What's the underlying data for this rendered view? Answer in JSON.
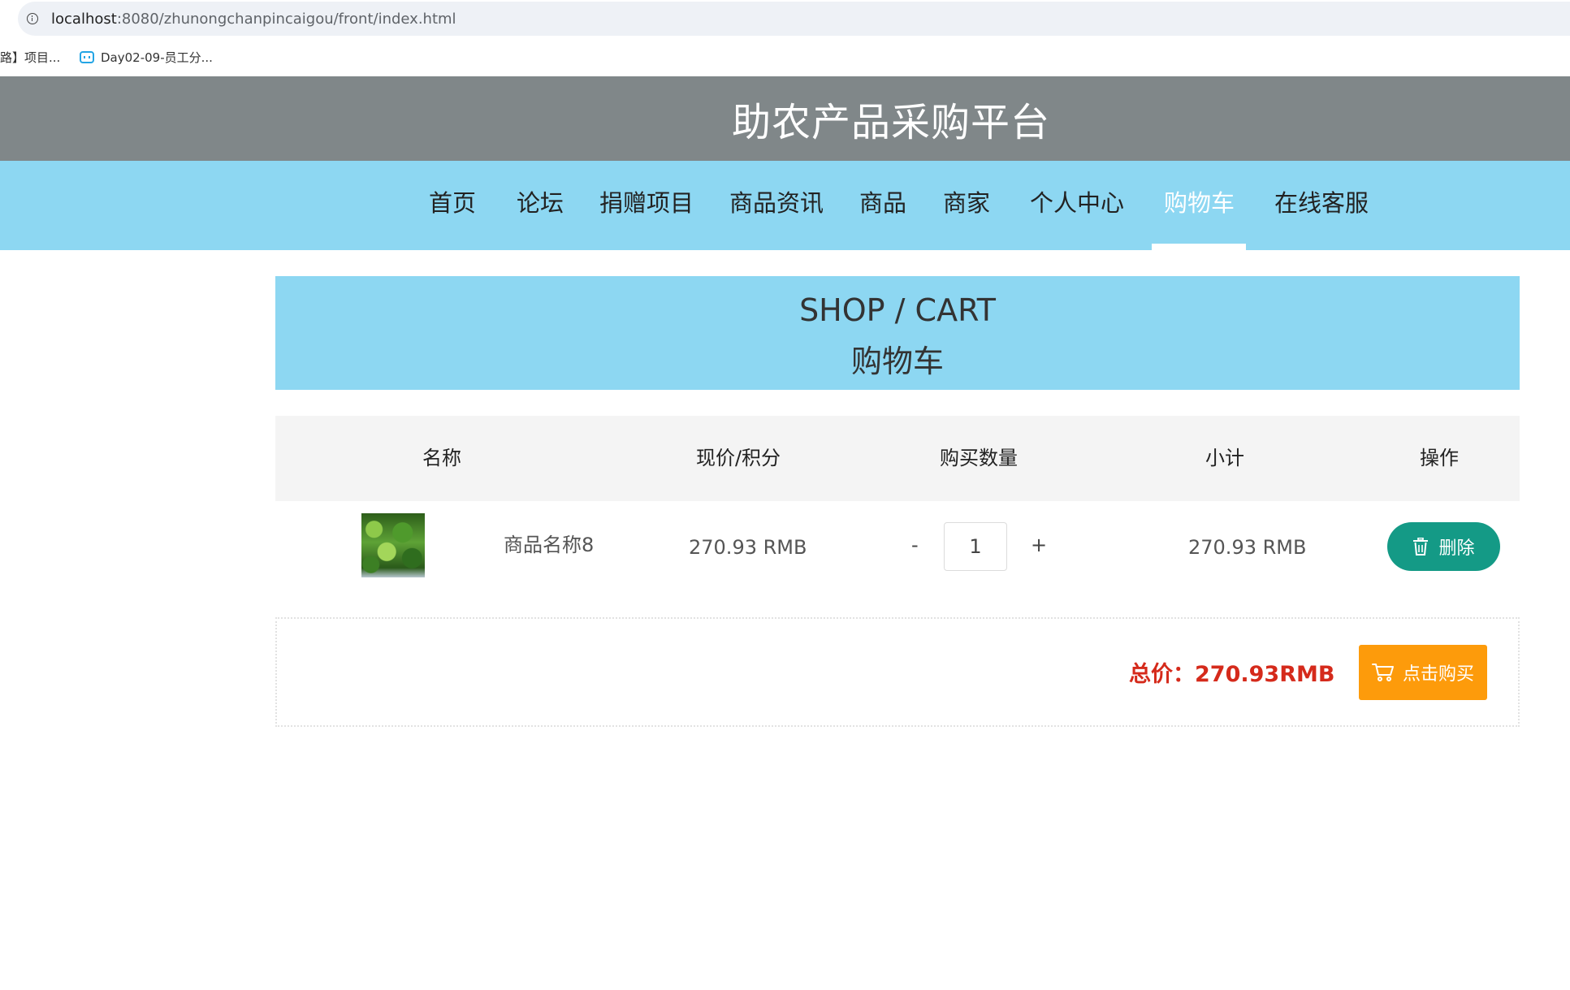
{
  "browser": {
    "url_host": "localhost",
    "url_rest": ":8080/zhunongchanpincaigou/front/index.html",
    "bookmarks": [
      "路】项目...",
      "Day02-09-员工分..."
    ]
  },
  "site": {
    "title": "助农产品采购平台"
  },
  "nav": {
    "items": [
      {
        "label": "首页"
      },
      {
        "label": "论坛"
      },
      {
        "label": "捐赠项目"
      },
      {
        "label": "商品资讯"
      },
      {
        "label": "商品"
      },
      {
        "label": "商家"
      },
      {
        "label": "个人中心"
      },
      {
        "label": "购物车",
        "active": true
      },
      {
        "label": "在线客服"
      }
    ]
  },
  "page": {
    "title_en": "SHOP / CART",
    "title_cn": "购物车"
  },
  "table": {
    "headers": [
      "名称",
      "现价/积分",
      "购买数量",
      "小计",
      "操作"
    ],
    "rows": [
      {
        "name": "商品名称8",
        "price": "270.93 RMB",
        "minus": "-",
        "quantity": "1",
        "plus": "+",
        "subtotal": "270.93 RMB",
        "delete_label": "删除"
      }
    ]
  },
  "summary": {
    "total_label": "总价：270.93RMB",
    "buy_label": "点击购买"
  },
  "colors": {
    "header_bg": "#808789",
    "nav_bg": "#8dd7f2",
    "delete_btn": "#149a86",
    "buy_btn": "#fd9b0b",
    "total_text": "#d52a1b"
  }
}
